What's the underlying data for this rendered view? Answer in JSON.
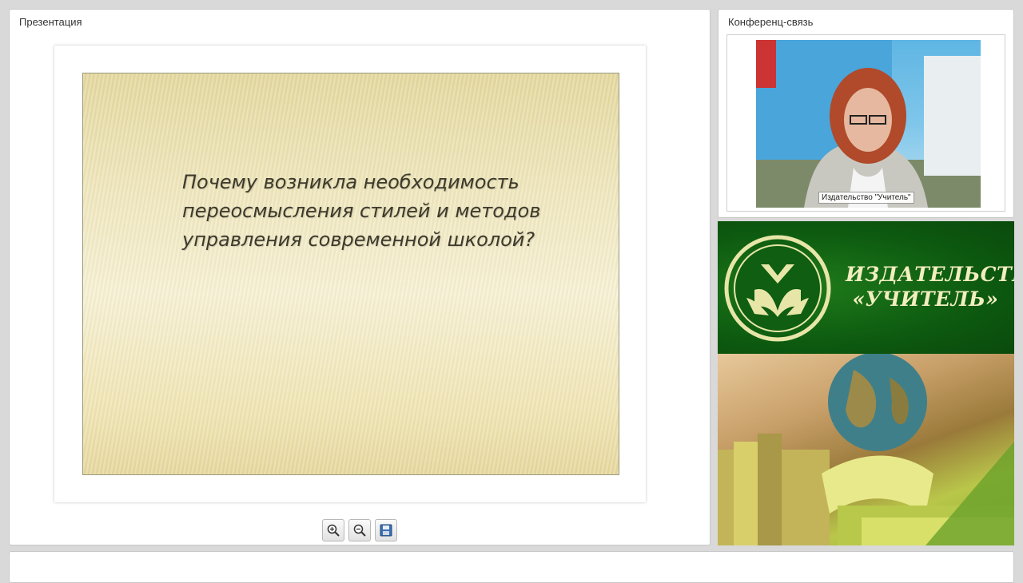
{
  "presentation": {
    "title": "Презентация",
    "slide_text": "Почему возникла необходимость переосмысления стилей и методов управления современной школой?"
  },
  "toolbar": {
    "buttons": [
      {
        "icon": "zoom-in-icon"
      },
      {
        "icon": "zoom-out-icon"
      },
      {
        "icon": "save-icon"
      }
    ]
  },
  "conference": {
    "title": "Конференц-связь",
    "participant_label": "Издательство \"Учитель\""
  },
  "banner": {
    "line1": "ИЗДАТЕЛЬСТВО",
    "line2": "«УЧИТЕЛЬ»"
  },
  "colors": {
    "banner_green": "#0d5a10",
    "brand_text": "#f2eec0"
  }
}
